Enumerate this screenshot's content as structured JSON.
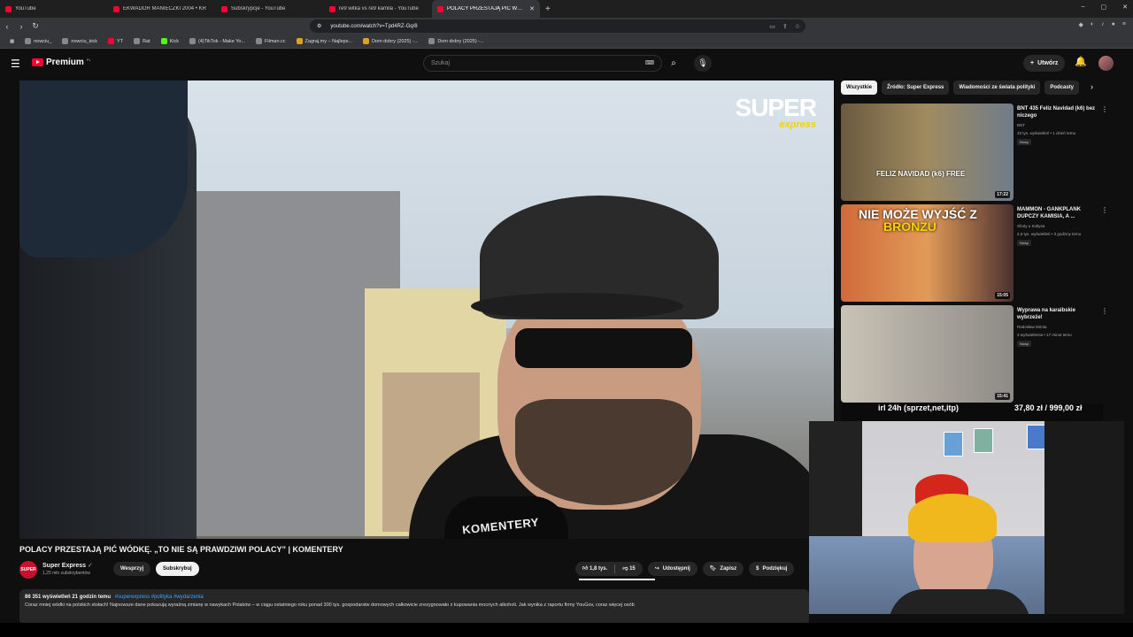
{
  "browser": {
    "tabs": [
      {
        "label": "YouTube",
        "active": false
      },
      {
        "label": "EKWADOR MANIECZKI 2004 • KR",
        "active": false
      },
      {
        "label": "Subskrypcje - YouTube",
        "active": false
      },
      {
        "label": "re9 witka vs re9 kamila - YouTube",
        "active": false
      },
      {
        "label": "POLACY PRZESTAJĄ PIĆ WÓDKI",
        "active": true
      }
    ],
    "url": "youtube.com/watch?v=Tpd4RZ-Gq/8",
    "bookmarks": [
      "nowciu_",
      "nowciu_kick",
      "YT",
      "Rat",
      "Kick",
      "(4)TikTok - Make Yo...",
      "Filman.cc",
      "Zagraj.my – Najleps...",
      "Dom dobry (2025) -...",
      "Dom dobry (2025) -..."
    ]
  },
  "header": {
    "logo_text": "Premium",
    "logo_sup": "PL",
    "search_placeholder": "Szukaj",
    "create_label": "Utwórz"
  },
  "video": {
    "brand_super": "SUPER",
    "brand_express": "express",
    "mic_text": "KOMENTERY",
    "title": "POLACY PRZESTAJĄ PIĆ WÓDKĘ. „TO NIE SĄ PRAWDZIWI POLACY” | KOMENTERY",
    "channel": {
      "avatar_text": "SUPER",
      "name": "Super Express",
      "subs": "1,25 mln subskrybentów"
    },
    "wesprzyj_label": "Wesprzyj",
    "subscribe_label": "Subskrybuj",
    "likes": "1,8 tys.",
    "dislikes": "15",
    "share_label": "Udostępnij",
    "save_label": "Zapisz",
    "thanks_label": "Podziękuj",
    "description": {
      "stats": "86 351 wyświetleń  21 godzin temu",
      "tags": "#superexpress #polityka #wydarzenia",
      "text": "Coraz mniej wódki na polskich stołach! Najnowsze dane pokazują wyraźną zmianę w nawykach Polaków – w ciągu ostatniego roku ponad 300 tys. gospodarstw domowych całkowicie zrezygnowało z kupowania mocnych alkoholi. Jak wynika z raportu firmy YouGov, coraz więcej osób"
    }
  },
  "sidebar": {
    "chips": [
      {
        "label": "Wszystkie",
        "active": true
      },
      {
        "label": "Źródło: Super Express",
        "active": false
      },
      {
        "label": "Wiadomości ze świata polityki",
        "active": false
      },
      {
        "label": "Podcasty",
        "active": false
      }
    ],
    "recommendations": [
      {
        "title": "BNT 435 Feliz Navidad (k6) bez niczego",
        "channel": "BNT",
        "meta": "33 tys. wyświetleń • 1 dzień temu",
        "badge": "Nowy",
        "duration": "17:22",
        "thumb_caption": "FELIZ NAVIDAD (k6) FREE"
      },
      {
        "title": "MAMMON - GANKPLANK DUPCZY KAMISIA, A ...",
        "channel": "Shoty u Soltysa",
        "meta": "2,6 tys. wyświetleń • 3 godziny temu",
        "badge": "Nowy",
        "duration": "15:05",
        "thumb_caption_top": "NIE MOŻE WYJŚĆ Z",
        "thumb_caption_bottom": "BRONZU"
      },
      {
        "title": "Wyprawa na karaibskie wybrzeże!",
        "channel": "Radosław Mirota",
        "meta": "3 wyświetlenia • 17 minut temu",
        "badge": "Nowy",
        "duration": "15:41"
      }
    ]
  },
  "overlay": {
    "goal_text": "irl 24h (sprzet,net,itp)",
    "price_text": "37,80 zł / 999,00 zł"
  }
}
